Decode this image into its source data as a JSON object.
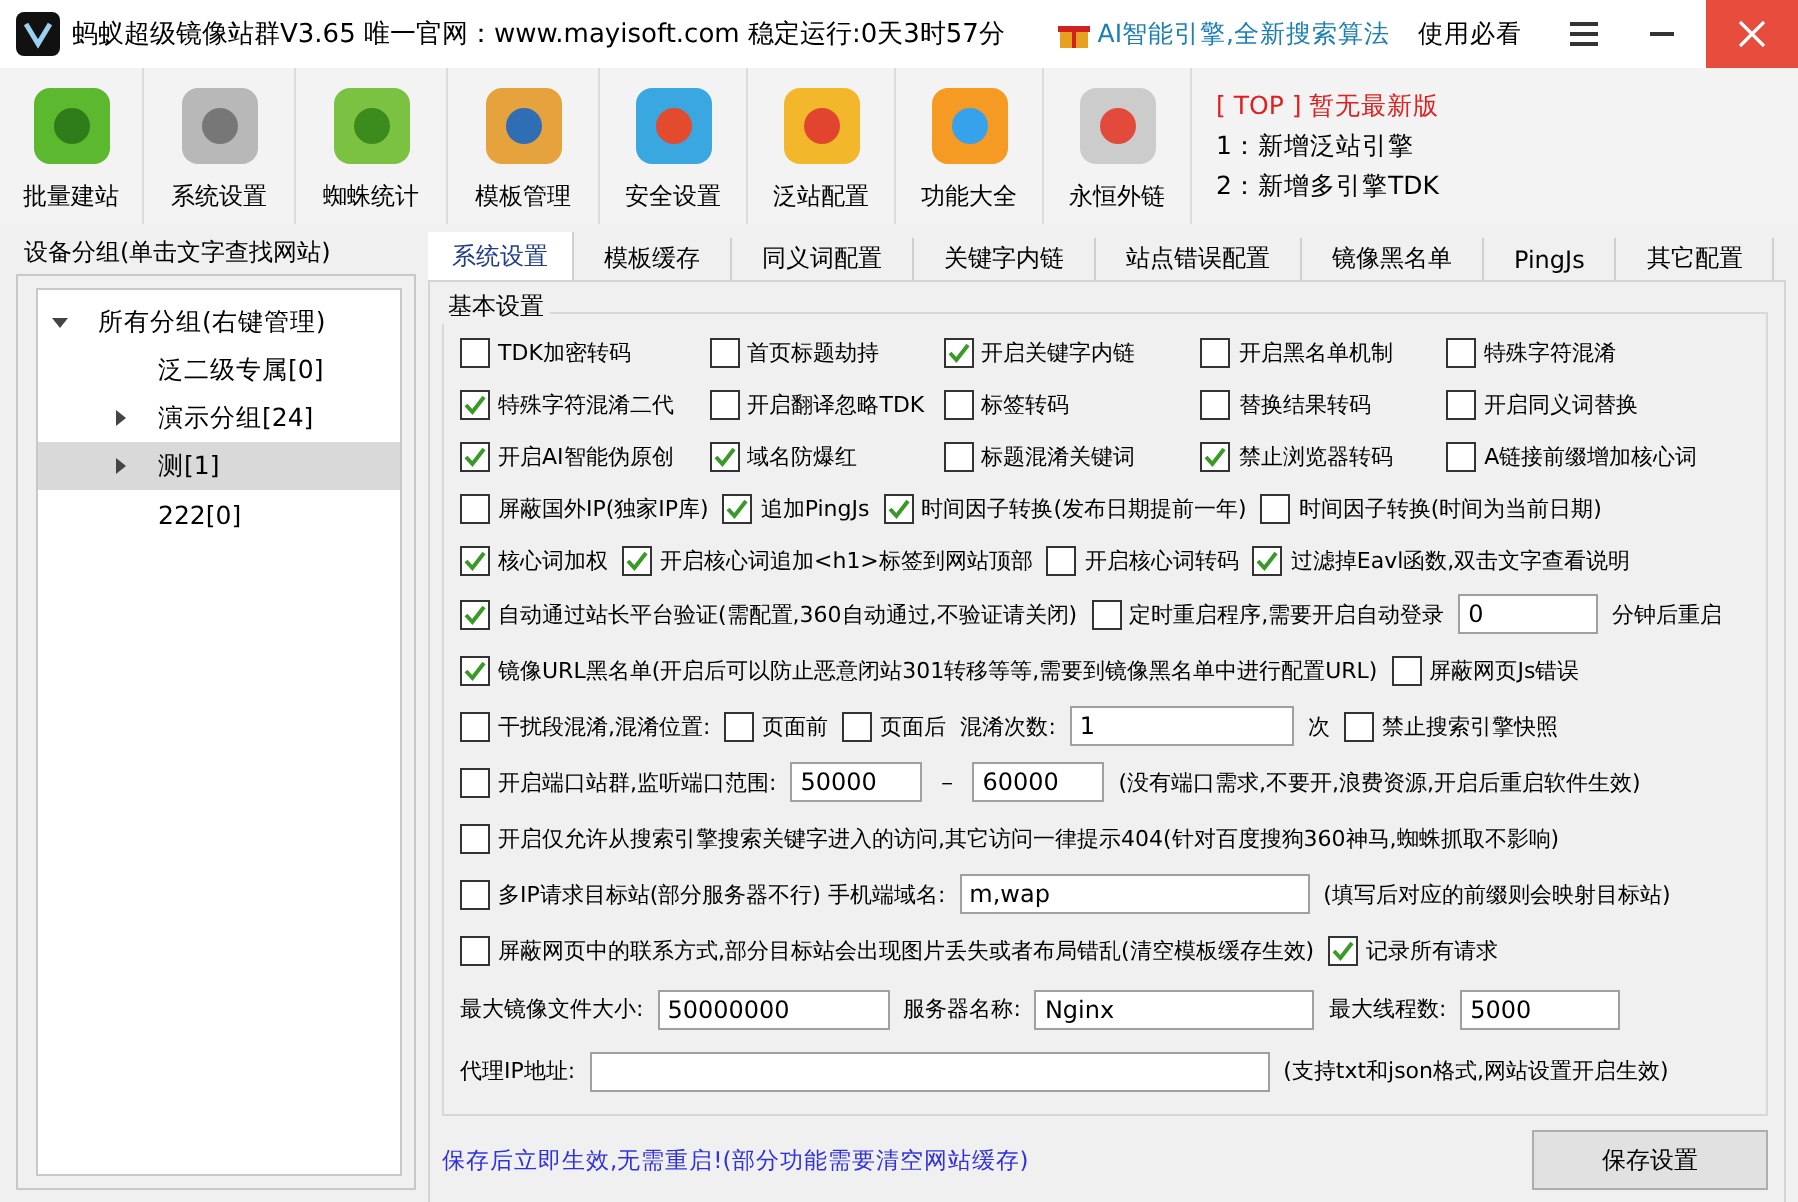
{
  "window": {
    "title": "蚂蚁超级镜像站群V3.65 唯一官网：www.mayisoft.com 稳定运行:0天3时57分",
    "promo": "AI智能引擎,全新搜索算法",
    "help": "使用必看"
  },
  "toolbar": [
    {
      "label": "批量建站"
    },
    {
      "label": "系统设置"
    },
    {
      "label": "蜘蛛统计"
    },
    {
      "label": "模板管理"
    },
    {
      "label": "安全设置"
    },
    {
      "label": "泛站配置"
    },
    {
      "label": "功能大全"
    },
    {
      "label": "永恒外链"
    }
  ],
  "news": {
    "headline": "[ TOP ] 暂无最新版",
    "items": [
      "1：新增泛站引擎",
      "2：新增多引擎TDK"
    ]
  },
  "sidebar": {
    "title": "设备分组(单击文字查找网站)",
    "tree": [
      {
        "label": "所有分组(右键管理)",
        "expanded": true,
        "selected": false,
        "children": [
          {
            "label": "泛二级专属[0]",
            "selected": false
          },
          {
            "label": "演示分组[24]",
            "expanded": false,
            "selected": false
          },
          {
            "label": "测[1]",
            "expanded": false,
            "selected": true
          },
          {
            "label": "222[0]",
            "selected": false
          }
        ]
      }
    ]
  },
  "tabs": [
    {
      "label": "系统设置",
      "selected": true
    },
    {
      "label": "模板缓存",
      "selected": false
    },
    {
      "label": "同义词配置",
      "selected": false
    },
    {
      "label": "关键字内链",
      "selected": false
    },
    {
      "label": "站点错误配置",
      "selected": false
    },
    {
      "label": "镜像黑名单",
      "selected": false
    },
    {
      "label": "PingJs",
      "selected": false
    },
    {
      "label": "其它配置",
      "selected": false
    }
  ],
  "section": {
    "title": "基本设置",
    "lines": [
      {
        "items": [
          {
            "kind": "checkbox",
            "label": "TDK加密转码",
            "checked": false
          },
          {
            "kind": "checkbox",
            "label": "首页标题劫持",
            "checked": false
          },
          {
            "kind": "checkbox",
            "label": "开启关键字内链",
            "checked": true
          },
          {
            "kind": "checkbox",
            "label": "开启黑名单机制",
            "checked": false
          },
          {
            "kind": "checkbox",
            "label": "特殊字符混淆",
            "checked": false
          }
        ]
      },
      {
        "items": [
          {
            "kind": "checkbox",
            "label": "特殊字符混淆二代",
            "checked": true
          },
          {
            "kind": "checkbox",
            "label": "开启翻译忽略TDK",
            "checked": false
          },
          {
            "kind": "checkbox",
            "label": "标签转码",
            "checked": false
          },
          {
            "kind": "checkbox",
            "label": "替换结果转码",
            "checked": false
          },
          {
            "kind": "checkbox",
            "label": "开启同义词替换",
            "checked": false
          }
        ]
      },
      {
        "items": [
          {
            "kind": "checkbox",
            "label": "开启AI智能伪原创",
            "checked": true
          },
          {
            "kind": "checkbox",
            "label": "域名防爆红",
            "checked": true
          },
          {
            "kind": "checkbox",
            "label": "标题混淆关键词",
            "checked": false
          },
          {
            "kind": "checkbox",
            "label": "禁止浏览器转码",
            "checked": true
          },
          {
            "kind": "checkbox",
            "label": "A链接前缀增加核心词",
            "checked": false
          }
        ]
      },
      {
        "items": [
          {
            "kind": "checkbox",
            "label": "屏蔽国外IP(独家IP库)",
            "checked": false
          },
          {
            "kind": "checkbox",
            "label": "追加PingJs",
            "checked": true
          },
          {
            "kind": "checkbox",
            "label": "时间因子转换(发布日期提前一年)",
            "checked": true
          },
          {
            "kind": "checkbox",
            "label": "时间因子转换(时间为当前日期)",
            "checked": false
          }
        ]
      },
      {
        "items": [
          {
            "kind": "checkbox",
            "label": "核心词加权",
            "checked": true
          },
          {
            "kind": "checkbox",
            "label": "开启核心词追加<h1>标签到网站顶部",
            "checked": true
          },
          {
            "kind": "checkbox",
            "label": "开启核心词转码",
            "checked": false
          },
          {
            "kind": "checkbox",
            "label": "过滤掉Eavl函数,双击文字查看说明",
            "checked": true
          }
        ]
      },
      {
        "items": [
          {
            "kind": "checkbox",
            "label": "自动通过站长平台验证(需配置,360自动通过,不验证请关闭)",
            "checked": true
          },
          {
            "kind": "checkbox",
            "label": "定时重启程序,需要开启自动登录",
            "checked": false
          },
          {
            "kind": "input",
            "value": "0"
          },
          {
            "kind": "label",
            "text": "分钟后重启"
          }
        ]
      },
      {
        "items": [
          {
            "kind": "checkbox",
            "label": "镜像URL黑名单(开启后可以防止恶意闭站301转移等等,需要到镜像黑名单中进行配置URL)",
            "checked": true
          },
          {
            "kind": "checkbox",
            "label": "屏蔽网页Js错误",
            "checked": false
          }
        ]
      },
      {
        "items": [
          {
            "kind": "checkbox",
            "label": "干扰段混淆,混淆位置:",
            "checked": false
          },
          {
            "kind": "checkbox",
            "label": "页面前",
            "checked": false
          },
          {
            "kind": "checkbox",
            "label": "页面后",
            "checked": false
          },
          {
            "kind": "label",
            "text": "混淆次数:"
          },
          {
            "kind": "input",
            "value": "1"
          },
          {
            "kind": "label",
            "text": "次"
          },
          {
            "kind": "checkbox",
            "label": "禁止搜索引擎快照",
            "checked": false
          }
        ]
      },
      {
        "items": [
          {
            "kind": "checkbox",
            "label": "开启端口站群,监听端口范围:",
            "checked": false
          },
          {
            "kind": "input",
            "value": "50000"
          },
          {
            "kind": "label",
            "text": "－"
          },
          {
            "kind": "input",
            "value": "60000"
          },
          {
            "kind": "label",
            "text": "(没有端口需求,不要开,浪费资源,开启后重启软件生效)"
          }
        ]
      },
      {
        "items": [
          {
            "kind": "checkbox",
            "label": "开启仅允许从搜索引擎搜索关键字进入的访问,其它访问一律提示404(针对百度搜狗360神马,蜘蛛抓取不影响)",
            "checked": false
          }
        ]
      },
      {
        "items": [
          {
            "kind": "checkbox",
            "label": "多IP请求目标站(部分服务器不行) 手机端域名:",
            "checked": false
          },
          {
            "kind": "input",
            "value": "m,wap"
          },
          {
            "kind": "label",
            "text": "(填写后对应的前缀则会映射目标站)"
          }
        ]
      },
      {
        "items": [
          {
            "kind": "checkbox",
            "label": "屏蔽网页中的联系方式,部分目标站会出现图片丢失或者布局错乱(清空模板缓存生效)",
            "checked": false
          },
          {
            "kind": "checkbox",
            "label": "记录所有请求",
            "checked": true
          }
        ]
      },
      {
        "items": [
          {
            "kind": "label",
            "text": "最大镜像文件大小:"
          },
          {
            "kind": "input",
            "value": "50000000"
          },
          {
            "kind": "label",
            "text": "服务器名称:"
          },
          {
            "kind": "input",
            "value": "Nginx"
          },
          {
            "kind": "label",
            "text": "最大线程数:"
          },
          {
            "kind": "input",
            "value": "5000"
          }
        ]
      },
      {
        "items": [
          {
            "kind": "label",
            "text": "代理IP地址:"
          },
          {
            "kind": "input"
          },
          {
            "kind": "label",
            "text": "(支持txt和json格式,网站设置开启生效)"
          }
        ]
      }
    ]
  },
  "footer": {
    "note": "保存后立即生效,无需重启!(部分功能需要清空网站缓存)",
    "save": "保存设置"
  }
}
